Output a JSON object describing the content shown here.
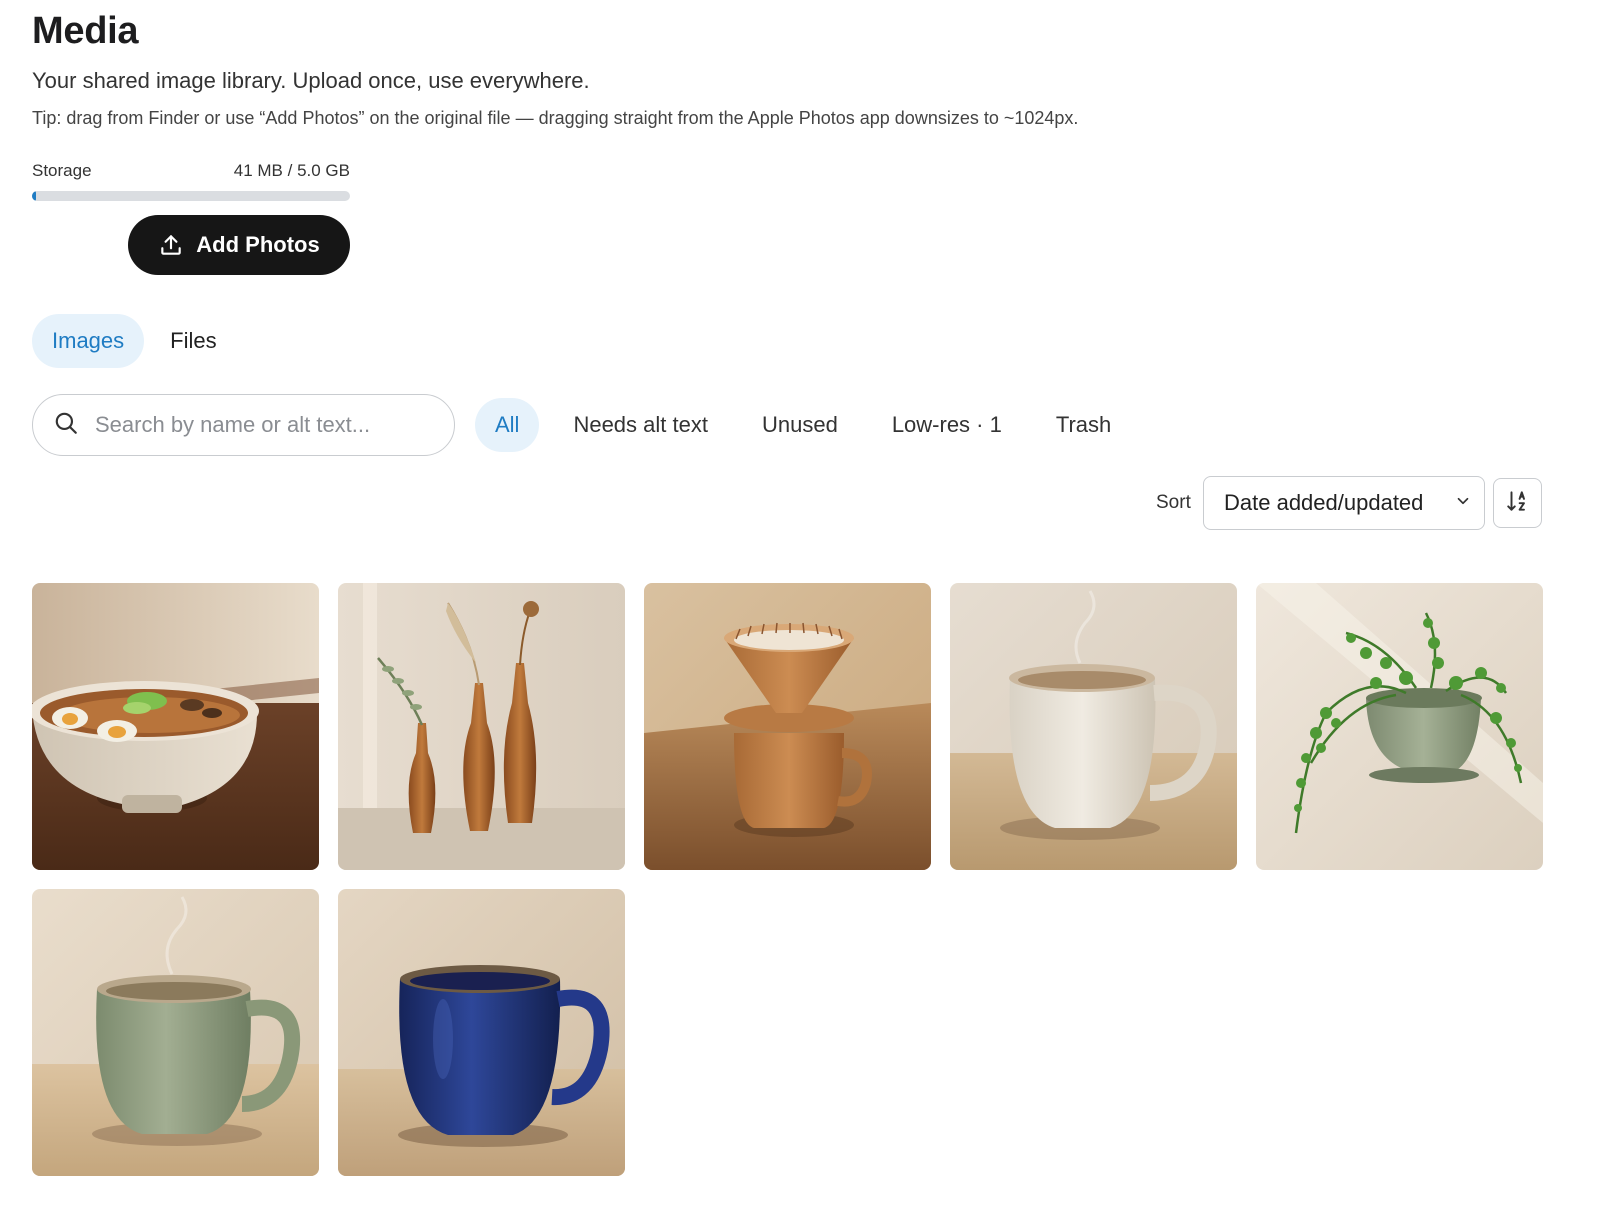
{
  "header": {
    "title": "Media",
    "subtitle": "Your shared image library. Upload once, use everywhere.",
    "tip": "Tip: drag from Finder or use “Add Photos” on the original file — dragging straight from the Apple Photos app downsizes to ~1024px."
  },
  "storage": {
    "label": "Storage",
    "value": "41 MB / 5.0 GB",
    "used_fraction": 0.008
  },
  "add_photos": {
    "label": "Add Photos",
    "icon": "upload-icon"
  },
  "tabs": [
    {
      "label": "Images",
      "active": true
    },
    {
      "label": "Files",
      "active": false
    }
  ],
  "search": {
    "placeholder": "Search by name or alt text...",
    "value": "",
    "icon": "search-icon"
  },
  "filters": [
    {
      "label": "All",
      "active": true
    },
    {
      "label": "Needs alt text",
      "active": false
    },
    {
      "label": "Unused",
      "active": false
    },
    {
      "label": "Low-res · 1",
      "active": false
    },
    {
      "label": "Trash",
      "active": false
    }
  ],
  "sort": {
    "label": "Sort",
    "selected": "Date added/updated",
    "direction_icon": "sort-a-z-icon"
  },
  "colors": {
    "accent": "#1f7cc3",
    "accent_bg": "#e6f2fb",
    "button_dark": "#161616"
  },
  "images": [
    {
      "subject": "ramen-bowl"
    },
    {
      "subject": "bud-vases"
    },
    {
      "subject": "pour-over-dripper"
    },
    {
      "subject": "cream-mug"
    },
    {
      "subject": "hanging-fern-planter"
    },
    {
      "subject": "sage-green-mug"
    },
    {
      "subject": "cobalt-blue-mug"
    }
  ]
}
